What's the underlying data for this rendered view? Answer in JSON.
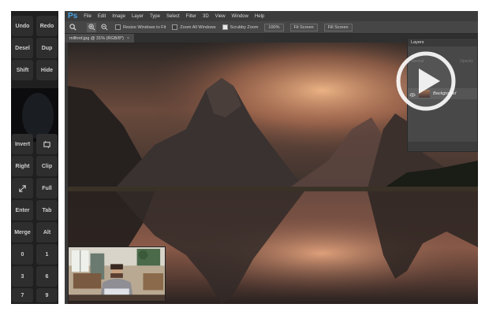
{
  "keypad": {
    "keys": [
      "Undo",
      "Redo",
      "Desel",
      "Dup",
      "Shift",
      "Hide",
      "Invert",
      "",
      "Right",
      "Clip",
      "",
      "Full",
      "Enter",
      "Tab",
      "Merge",
      "Alt",
      "0",
      "1",
      "3",
      "6",
      "7",
      "9"
    ]
  },
  "app": {
    "logo": "Ps",
    "menu": [
      "File",
      "Edit",
      "Image",
      "Layer",
      "Type",
      "Select",
      "Filter",
      "3D",
      "View",
      "Window",
      "Help"
    ]
  },
  "options": {
    "resize_windows": "Resize Windows to Fit",
    "zoom_all_windows": "Zoom All Windows",
    "scrubby_zoom": "Scrubby Zoom",
    "zoom_level": "100%",
    "fit_screen": "Fit Screen",
    "fill_screen": "Fill Screen"
  },
  "document": {
    "tab_title": "milford.jpg @ 31% (RGB/8*)",
    "close_glyph": "×"
  },
  "layers_panel": {
    "title": "Layers",
    "mode_hint": "Normal",
    "opacity_hint": "Opacity",
    "layer_name": "Background"
  },
  "colors": {
    "ps_blue": "#4aa3e6",
    "sky_glow": "#e8a070"
  }
}
